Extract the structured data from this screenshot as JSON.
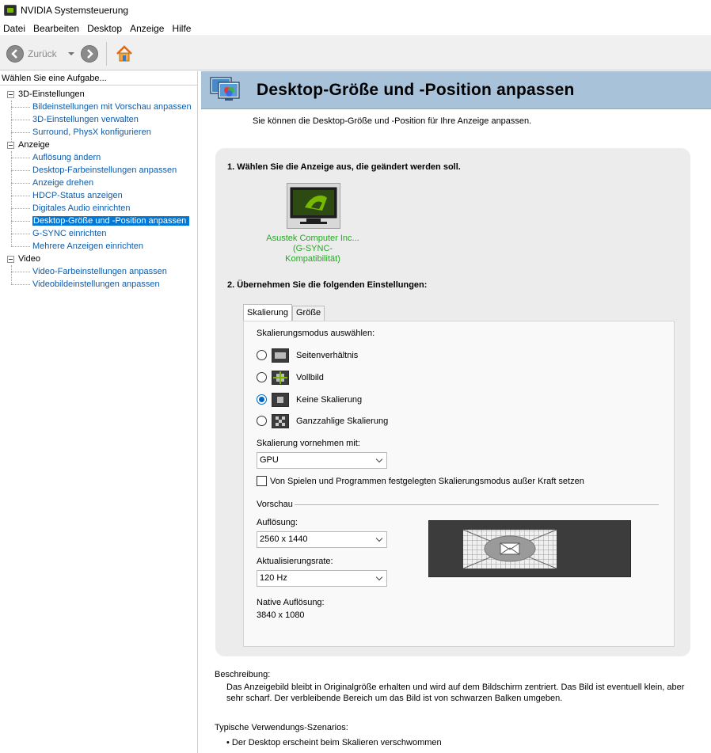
{
  "window": {
    "title": "NVIDIA Systemsteuerung"
  },
  "menu": [
    "Datei",
    "Bearbeiten",
    "Desktop",
    "Anzeige",
    "Hilfe"
  ],
  "toolbar": {
    "back_label": "Zurück"
  },
  "sidebar": {
    "header": "Wählen Sie eine Aufgabe...",
    "categories": [
      {
        "label": "3D-Einstellungen",
        "items": [
          "Bildeinstellungen mit Vorschau anpassen",
          "3D-Einstellungen verwalten",
          "Surround, PhysX konfigurieren"
        ]
      },
      {
        "label": "Anzeige",
        "items": [
          "Auflösung ändern",
          "Desktop-Farbeinstellungen anpassen",
          "Anzeige drehen",
          "HDCP-Status anzeigen",
          "Digitales Audio einrichten",
          "Desktop-Größe und -Position anpassen",
          "G-SYNC einrichten",
          "Mehrere Anzeigen einrichten"
        ]
      },
      {
        "label": "Video",
        "items": [
          "Video-Farbeinstellungen anpassen",
          "Videobildeinstellungen anpassen"
        ]
      }
    ],
    "selected": "Desktop-Größe und -Position anpassen"
  },
  "page": {
    "title": "Desktop-Größe und -Position anpassen",
    "description": "Sie können die Desktop-Größe und -Position für Ihre Anzeige anpassen.",
    "step1": "1. Wählen Sie die Anzeige aus, die geändert werden soll.",
    "display_name": "Asustek Computer Inc...",
    "display_status": "(G-SYNC-Kompatibilität)",
    "step2": "2. Übernehmen Sie die folgenden Einstellungen:",
    "tabs": [
      "Skalierung",
      "Größe"
    ],
    "scaling_mode_label": "Skalierungsmodus auswählen:",
    "scaling_modes": [
      "Seitenverhältnis",
      "Vollbild",
      "Keine Skalierung",
      "Ganzzahlige Skalierung"
    ],
    "scaling_mode_selected": "Keine Skalierung",
    "perform_scaling_label": "Skalierung vornehmen mit:",
    "perform_scaling_value": "GPU",
    "override_checkbox_label": "Von Spielen und Programmen festgelegten Skalierungsmodus außer Kraft setzen",
    "override_checked": false,
    "preview_label": "Vorschau",
    "resolution_label": "Auflösung:",
    "resolution_value": "2560 x 1440",
    "refresh_label": "Aktualisierungsrate:",
    "refresh_value": "120 Hz",
    "native_label": "Native Auflösung:",
    "native_value": "3840 x 1080",
    "beschreibung_label": "Beschreibung:",
    "beschreibung_text": "Das Anzeigebild bleibt in Originalgröße erhalten und wird auf dem Bildschirm zentriert. Das Bild ist eventuell klein, aber sehr scharf. Der verbleibende Bereich um das Bild ist von schwarzen Balken umgeben.",
    "usage_label": "Typische Verwendungs-Szenarios:",
    "usage_items": [
      "Der Desktop erscheint beim Skalieren verschwommen"
    ]
  },
  "colors": {
    "header_band": "#a8c3d9",
    "link": "#0d5cab",
    "selection": "#0078d7",
    "display_label": "#25a825",
    "nvidia_green": "#76b900"
  }
}
